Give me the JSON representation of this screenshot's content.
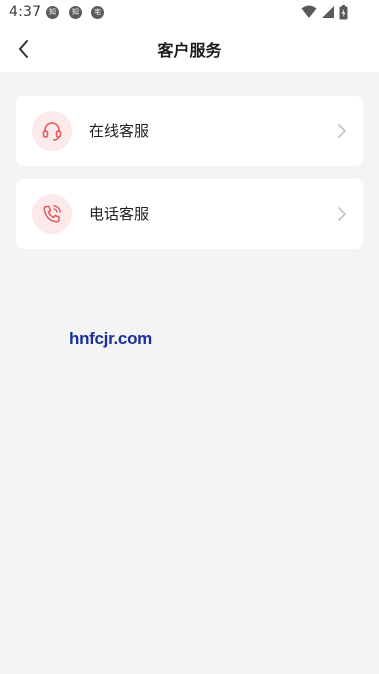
{
  "status_bar": {
    "time": "4:37",
    "notifications": [
      "知",
      "知",
      "宅"
    ]
  },
  "header": {
    "title": "客户服务",
    "back_icon": "chevron-left-icon"
  },
  "menu": {
    "items": [
      {
        "label": "在线客服",
        "icon": "headset-icon",
        "icon_color": "#e05a5a"
      },
      {
        "label": "电话客服",
        "icon": "phone-icon",
        "icon_color": "#e05a5a"
      }
    ]
  },
  "watermark": "hnfcjr.com",
  "colors": {
    "background": "#f4f4f4",
    "card": "#ffffff",
    "icon_bg": "#fce9e9",
    "accent": "#e05a5a",
    "watermark": "#1a2f9a"
  }
}
